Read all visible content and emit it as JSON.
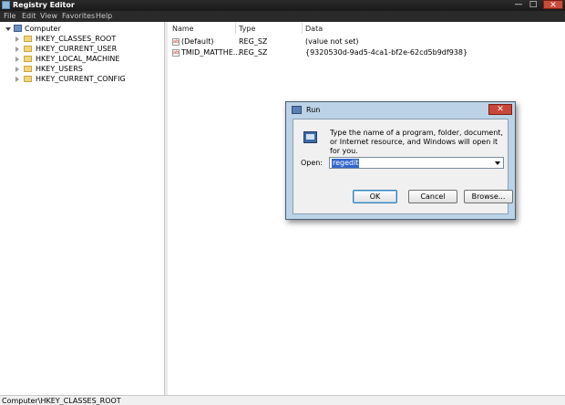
{
  "window": {
    "title": "Registry Editor",
    "controls": {
      "minimize": "—",
      "maximize": "□",
      "close": "✕"
    }
  },
  "menu": [
    "File",
    "Edit",
    "View",
    "Favorites",
    "Help"
  ],
  "tree": {
    "root": "Computer",
    "items": [
      "HKEY_CLASSES_ROOT",
      "HKEY_CURRENT_USER",
      "HKEY_LOCAL_MACHINE",
      "HKEY_USERS",
      "HKEY_CURRENT_CONFIG"
    ]
  },
  "list": {
    "columns": [
      "Name",
      "Type",
      "Data"
    ],
    "rows": [
      {
        "name": "(Default)",
        "type": "REG_SZ",
        "data": "(value not set)"
      },
      {
        "name": "TMID_MATTHE...",
        "type": "REG_SZ",
        "data": "{9320530d-9ad5-4ca1-bf2e-62cd5b9df938}"
      }
    ]
  },
  "status": "Computer\\HKEY_CLASSES_ROOT",
  "run_dialog": {
    "title": "Run",
    "description": "Type the name of a program, folder, document, or Internet resource, and Windows will open it for you.",
    "open_label": "Open:",
    "open_value": "regedit",
    "buttons": {
      "ok": "OK",
      "cancel": "Cancel",
      "browse": "Browse..."
    },
    "close": "✕"
  }
}
